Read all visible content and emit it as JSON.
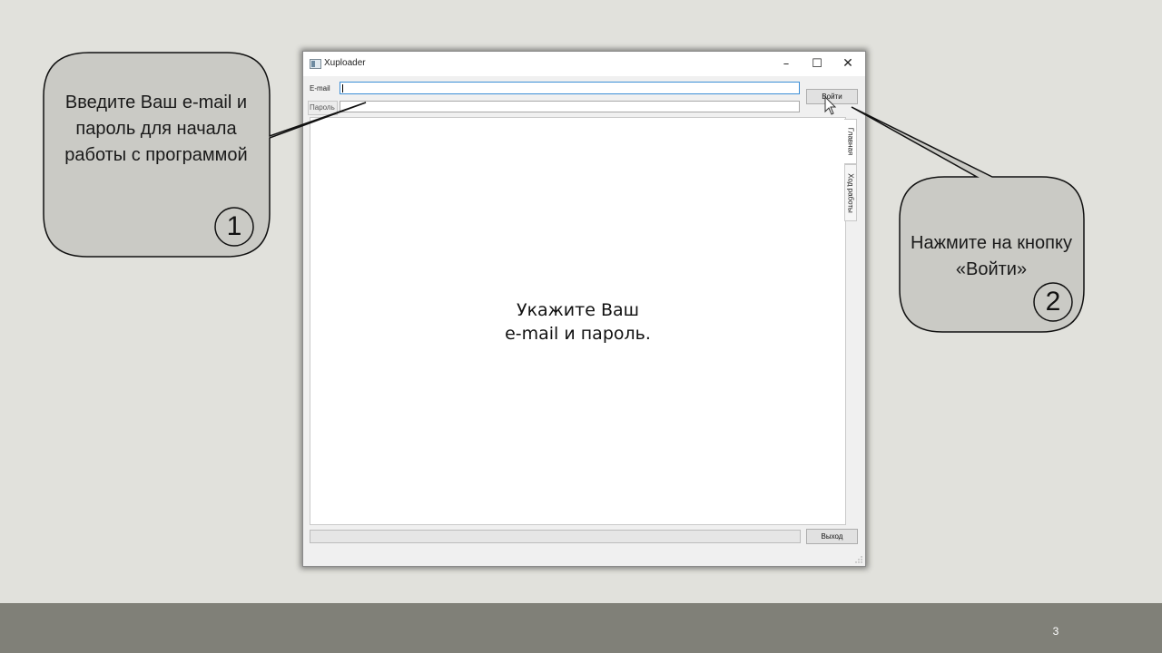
{
  "window": {
    "title": "Xuploader",
    "minimize_glyph": "–",
    "maximize_glyph": "☐",
    "close_glyph": "✕"
  },
  "form": {
    "email_label": "E-mail",
    "email_value": "",
    "password_label": "Пароль",
    "password_value": "",
    "login_button": "Войти"
  },
  "content": {
    "message_line1": "Укажите Ваш",
    "message_line2": "e-mail и пароль."
  },
  "tabs": [
    {
      "label": "Главная",
      "selected": true
    },
    {
      "label": "Ход работы",
      "selected": false
    }
  ],
  "footer": {
    "progress_fraction": 0,
    "exit_button": "Выход"
  },
  "callouts": [
    {
      "text": "Введите Ваш e-mail и пароль для начала работы с программой",
      "number": "1"
    },
    {
      "text": "Нажмите на кнопку «Войти»",
      "number": "2"
    }
  ],
  "slide": {
    "number": "3"
  },
  "colors": {
    "slide_background": "#e1e1dc",
    "footer_bar": "#808078",
    "callout_fill": "#cacac5",
    "focus_border": "#3b8ed6"
  },
  "icons": {
    "app": "app-window-icon",
    "cursor": "mouse-pointer-icon",
    "grip": "resize-grip-icon"
  }
}
